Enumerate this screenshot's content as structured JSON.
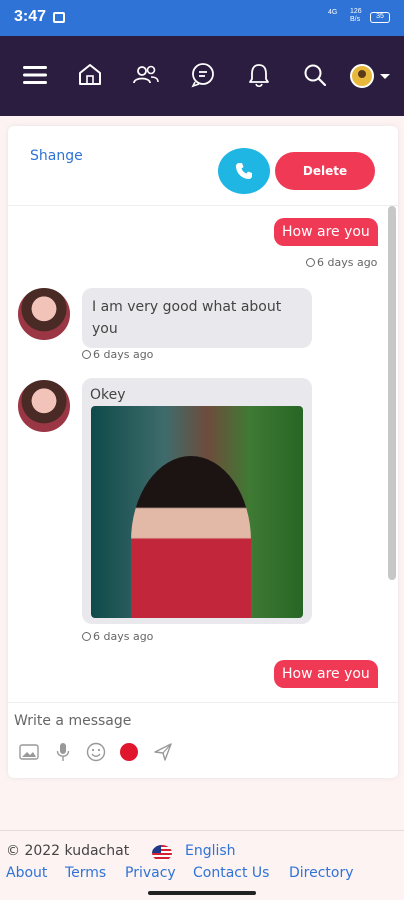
{
  "status_bar": {
    "time": "3:47",
    "network": "4G",
    "speed_value": "126",
    "speed_unit": "B/s",
    "battery": "35"
  },
  "nav": {
    "icons": [
      "menu-icon",
      "home-icon",
      "friends-icon",
      "messages-icon",
      "notifications-icon",
      "search-icon",
      "profile-avatar"
    ]
  },
  "chat": {
    "header_title": "Shange",
    "delete_label": "Delete",
    "messages": [
      {
        "direction": "out",
        "text": "How are you",
        "time": "6 days ago"
      },
      {
        "direction": "in",
        "text": "I am very good what about you",
        "time": "6 days ago"
      },
      {
        "direction": "in",
        "text": "Okey",
        "time": "6 days ago",
        "has_image": true
      },
      {
        "direction": "out",
        "text": "How are you"
      }
    ],
    "composer_placeholder": "Write a message"
  },
  "footer": {
    "copyright": "© 2022 kudachat",
    "language": "English",
    "links": [
      "About",
      "Terms",
      "Privacy",
      "Contact Us",
      "Directory"
    ]
  },
  "colors": {
    "nav_bg": "#2b1d3f",
    "status_bg": "#2f73d6",
    "accent": "#f03a55",
    "call": "#1fb6e3"
  }
}
